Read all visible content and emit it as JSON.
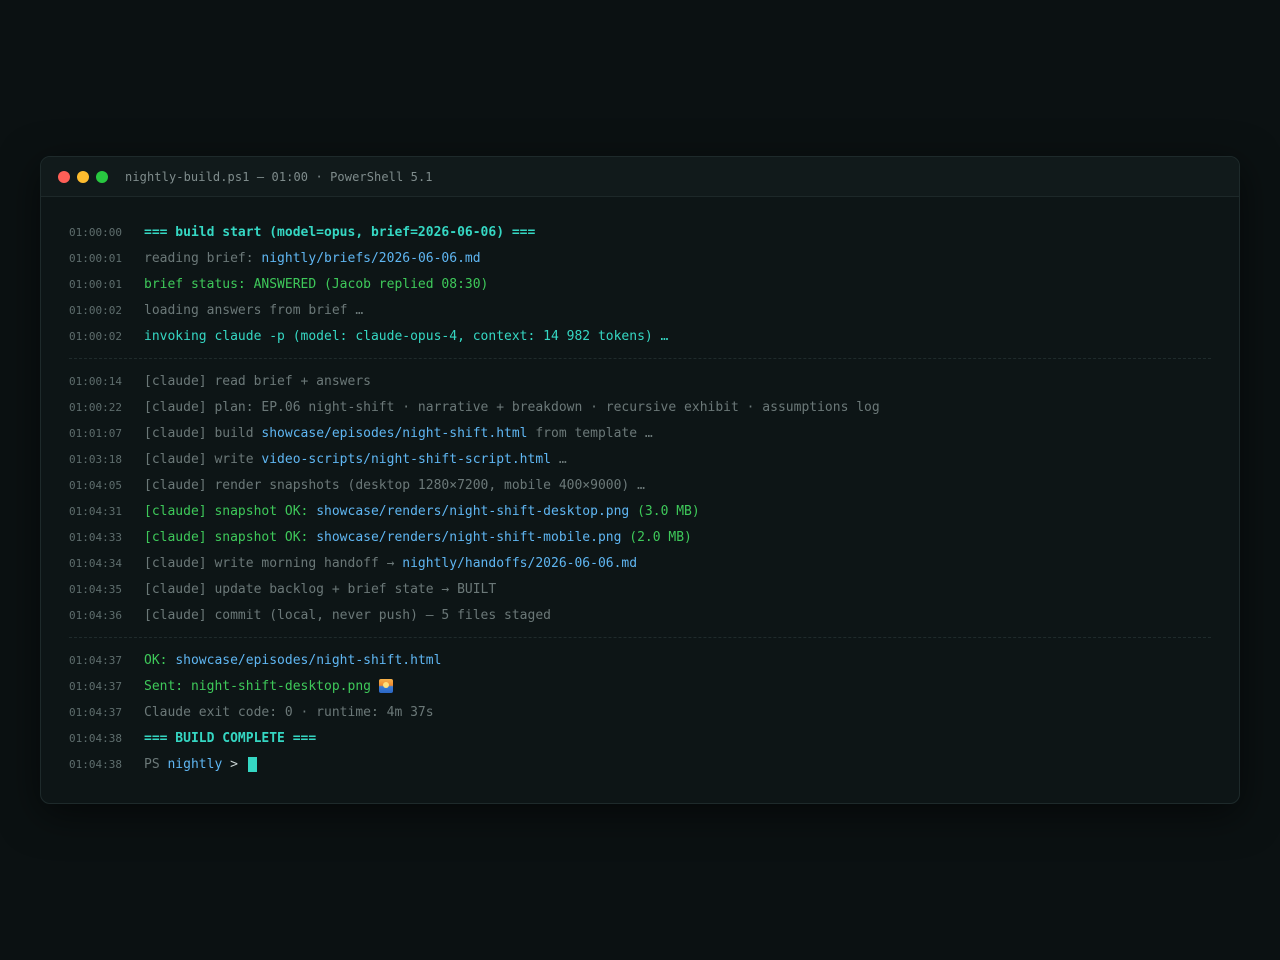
{
  "window": {
    "title": "nightly-build.ps1 — 01:00 · PowerShell 5.1"
  },
  "colors": {
    "cyan": "#35d7c3",
    "path": "#5fb6f2",
    "green": "#3ec95a",
    "gray": "#6b7878",
    "background": "#0d1516"
  },
  "log": {
    "l1": {
      "ts": "01:00:00",
      "text": "=== build start (model=opus, brief=2026-06-06) ==="
    },
    "l2": {
      "ts": "01:00:01",
      "prefix": "reading brief: ",
      "path": "nightly/briefs/2026-06-06.md"
    },
    "l3": {
      "ts": "01:00:01",
      "text": "brief status: ANSWERED (Jacob replied 08:30)"
    },
    "l4": {
      "ts": "01:00:02",
      "text": "loading answers from brief …"
    },
    "l5": {
      "ts": "01:00:02",
      "text": "invoking claude -p (model: claude-opus-4, context: 14 982 tokens) …"
    },
    "l6": {
      "ts": "01:00:14",
      "text": "[claude] read brief + answers"
    },
    "l7": {
      "ts": "01:00:22",
      "text": "[claude] plan: EP.06 night-shift · narrative + breakdown · recursive exhibit · assumptions log"
    },
    "l8": {
      "ts": "01:01:07",
      "prefix": "[claude] build ",
      "path": "showcase/episodes/night-shift.html",
      "suffix": " from template …"
    },
    "l9": {
      "ts": "01:03:18",
      "prefix": "[claude] write ",
      "path": "video-scripts/night-shift-script.html",
      "suffix": " …"
    },
    "l10": {
      "ts": "01:04:05",
      "text": "[claude] render snapshots (desktop 1280×7200, mobile 400×9000) …"
    },
    "l11": {
      "ts": "01:04:31",
      "prefix": "[claude] snapshot OK: ",
      "path": "showcase/renders/night-shift-desktop.png",
      "suffix": " (3.0 MB)"
    },
    "l12": {
      "ts": "01:04:33",
      "prefix": "[claude] snapshot OK: ",
      "path": "showcase/renders/night-shift-mobile.png",
      "suffix": " (2.0 MB)"
    },
    "l13": {
      "ts": "01:04:34",
      "prefix": "[claude] write morning handoff → ",
      "path": "nightly/handoffs/2026-06-06.md"
    },
    "l14": {
      "ts": "01:04:35",
      "text": "[claude] update backlog + brief state → BUILT"
    },
    "l15": {
      "ts": "01:04:36",
      "text": "[claude] commit (local, never push) — 5 files staged"
    },
    "l16": {
      "ts": "01:04:37",
      "prefix": "OK: ",
      "path": "showcase/episodes/night-shift.html"
    },
    "l17": {
      "ts": "01:04:37",
      "text": "Sent: night-shift-desktop.png ",
      "icon": "sunrise-emoji-icon"
    },
    "l18": {
      "ts": "01:04:37",
      "text": "Claude exit code: 0 · runtime: 4m 37s"
    },
    "l19": {
      "ts": "01:04:38",
      "text": "=== BUILD COMPLETE ==="
    },
    "l20": {
      "ts": "01:04:38",
      "prefix": "PS ",
      "path": "nightly",
      "suffix": " > "
    }
  }
}
